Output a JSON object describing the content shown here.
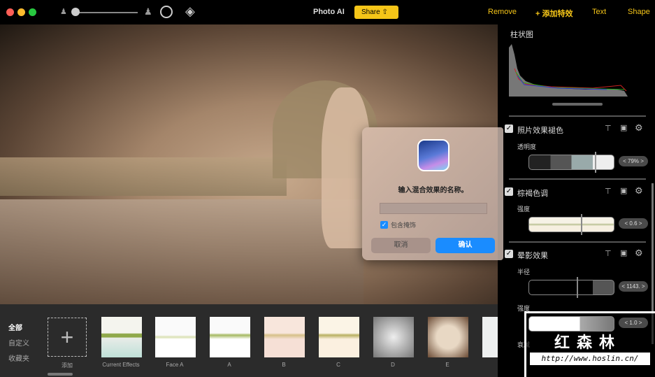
{
  "topbar": {
    "title": "Photo AI",
    "share": "Share",
    "remove": "Remove",
    "add_effect": "+ 添加特效",
    "text": "Text",
    "shape": "Shape"
  },
  "panel": {
    "histogram_title": "柱状图",
    "effects": [
      {
        "name": "照片效果褪色",
        "param": "透明度",
        "value": "< 79% >",
        "level": 0.79
      },
      {
        "name": "棕褐色调",
        "param": "强度",
        "value": "< 0.6 >",
        "level": 0.6
      },
      {
        "name": "晕影效果",
        "param": "半径",
        "value": "< 1143. >",
        "param2": "强度",
        "value2": "< 1.0 >",
        "param3": "衰减"
      }
    ]
  },
  "dialog": {
    "message": "输入混合效果的名称。",
    "input_value": "",
    "include_mask": "包含掩饰",
    "cancel": "取消",
    "confirm": "确认"
  },
  "bottom": {
    "categories": [
      "全部",
      "自定义",
      "收藏夹"
    ],
    "add": "添加",
    "presets": [
      "Current Effects",
      "Face A",
      "A",
      "B",
      "C",
      "D",
      "E"
    ]
  },
  "watermark": {
    "text": "红森林",
    "url": "http://www.hoslin.cn/"
  },
  "colors": {
    "accent": "#f5c518",
    "confirm": "#1a8cff"
  }
}
